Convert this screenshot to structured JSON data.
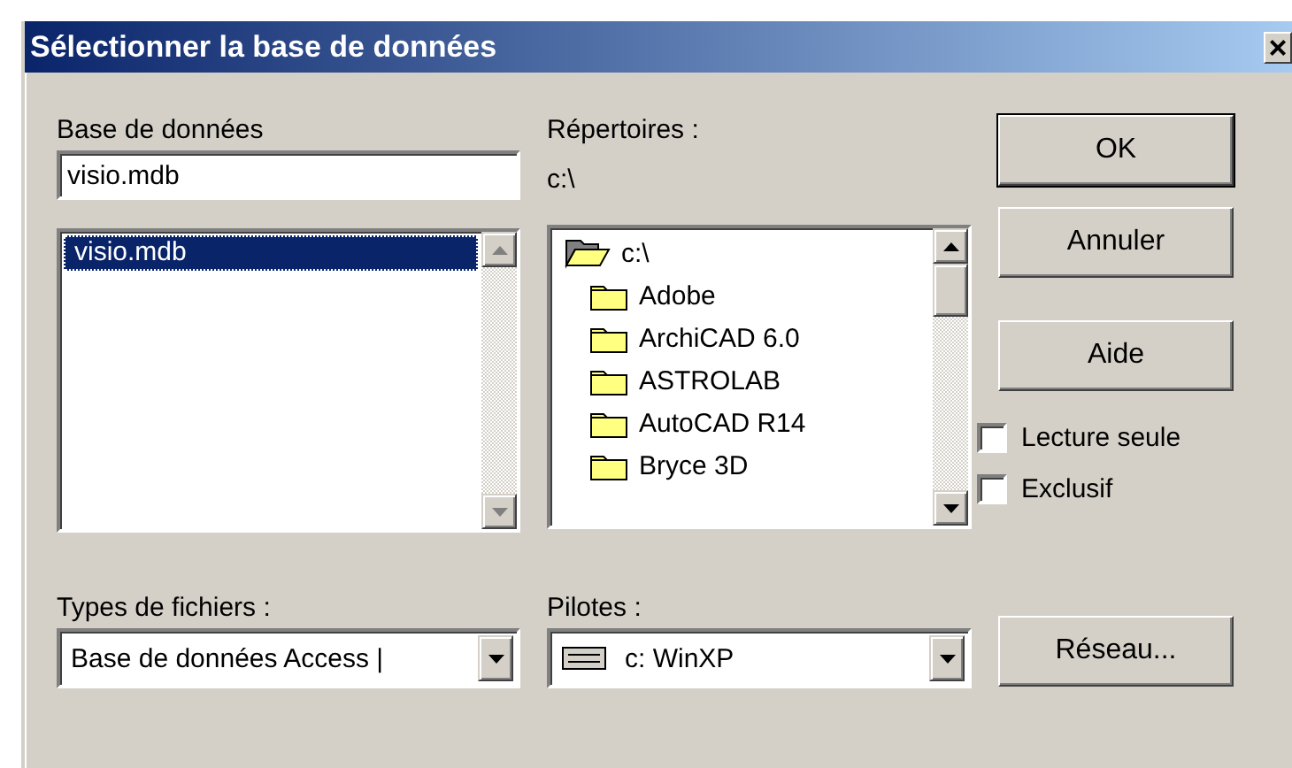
{
  "window": {
    "title": "Sélectionner la base de données",
    "close": "×"
  },
  "database": {
    "label": "Base de données",
    "value": "visio.mdb",
    "files": [
      {
        "name": "visio.mdb",
        "selected": true
      }
    ]
  },
  "directories": {
    "label": "Répertoires :",
    "path": "c:\\",
    "folders": [
      {
        "name": "c:\\",
        "kind": "open"
      },
      {
        "name": "Adobe",
        "kind": "closed"
      },
      {
        "name": "ArchiCAD 6.0",
        "kind": "closed"
      },
      {
        "name": "ASTROLAB",
        "kind": "closed"
      },
      {
        "name": "AutoCAD R14",
        "kind": "closed"
      },
      {
        "name": "Bryce 3D",
        "kind": "closed"
      }
    ]
  },
  "buttons": [
    {
      "label": "OK",
      "default": true
    },
    {
      "label": "Annuler",
      "default": false
    },
    {
      "label": "Aide",
      "default": false
    }
  ],
  "options": [
    {
      "label": "Lecture seule",
      "checked": false
    },
    {
      "label": "Exclusif",
      "checked": false
    }
  ],
  "file_types": {
    "label": "Types de fichiers :",
    "value": "Base de données Access |"
  },
  "drives": {
    "label": "Pilotes :",
    "value": "c: WinXP"
  },
  "network_button": {
    "label": "Réseau..."
  }
}
